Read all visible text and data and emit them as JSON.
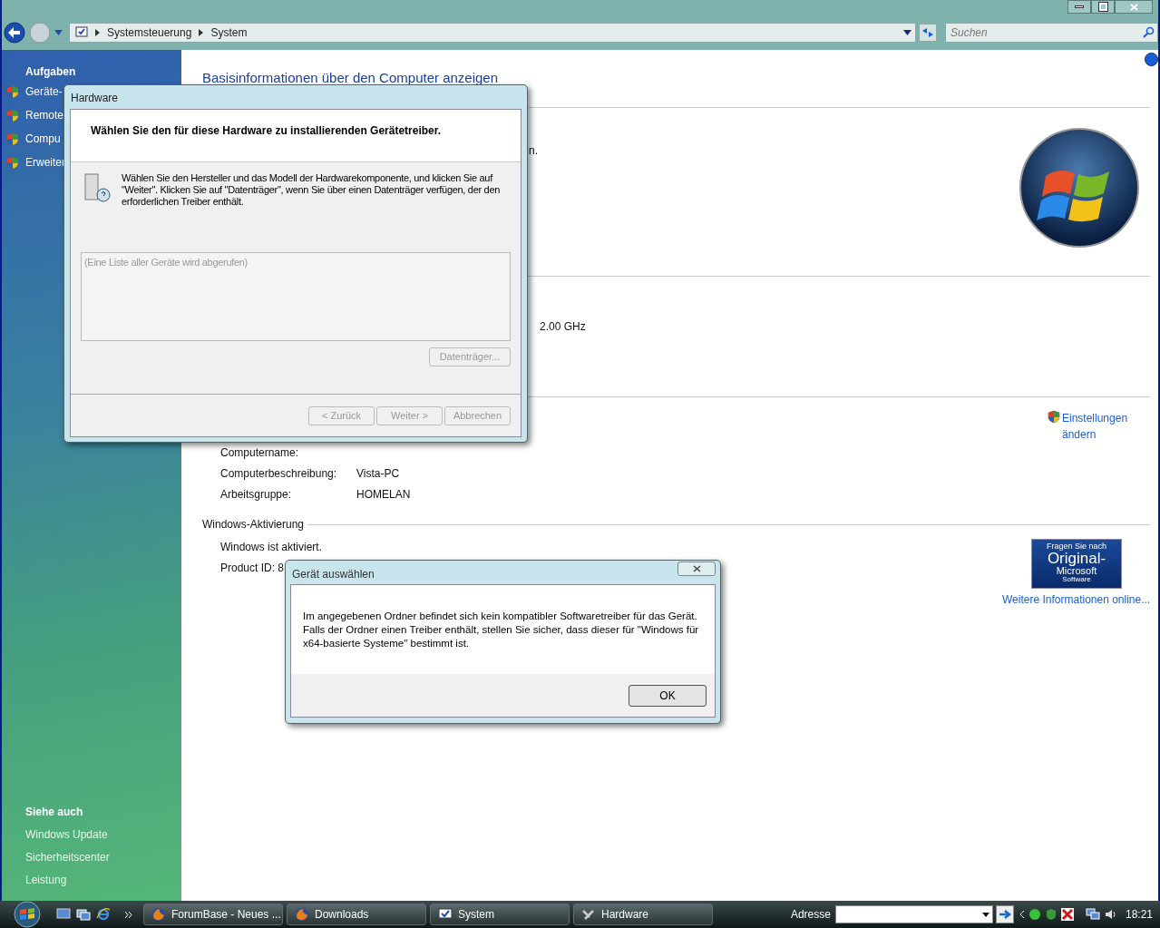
{
  "address_bar": {
    "breadcrumbs": [
      "Systemsteuerung",
      "System"
    ],
    "search": {
      "placeholder": "Suchen"
    }
  },
  "sidebar": {
    "tasks_heading": "Aufgaben",
    "tasks": [
      "Geräte-",
      "Remote",
      "Compu",
      "Erweiter"
    ],
    "see_also_heading": "Siehe auch",
    "see_also": [
      "Windows Update",
      "Sicherheitscenter",
      "Leistung"
    ]
  },
  "content": {
    "title": "Basisinformationen über den Computer anzeigen",
    "fragment_edition": "n.",
    "fragment_cpu": "2.00 GHz",
    "settings_link": "Einstellungen ändern",
    "computer_rows": [
      {
        "label": "Computername:"
      },
      {
        "label": "Computerbeschreibung:",
        "value": "Vista-PC"
      },
      {
        "label": "Arbeitsgruppe:",
        "value": "HOMELAN"
      }
    ],
    "activation": {
      "heading": "Windows-Aktivierung",
      "status": "Windows ist aktiviert.",
      "product_id": "Product ID: 8",
      "badge": {
        "line1": "Fragen Sie nach",
        "line2": "Original-",
        "line3": "Microsoft",
        "line4": "Software"
      },
      "link": "Weitere Informationen online..."
    }
  },
  "hardware_dialog": {
    "title": "Hardware",
    "heading": "Wählen Sie den für diese Hardware zu installierenden Gerätetreiber.",
    "instructions": "Wählen Sie den Hersteller und das Modell der Hardwarekomponente, und klicken Sie auf \"Weiter\". Klicken Sie auf \"Datenträger\", wenn Sie über einen Datenträger verfügen, der den erforderlichen Treiber enthält.",
    "list_placeholder": "(Eine Liste aller Geräte wird abgerufen)",
    "disk_button": {
      "label": "Datenträger...",
      "disabled": true
    },
    "buttons": [
      {
        "label": "< Zurück",
        "disabled": true
      },
      {
        "label": "Weiter >",
        "disabled": true
      },
      {
        "label": "Abbrechen",
        "disabled": true
      }
    ]
  },
  "message_dialog": {
    "title": "Gerät auswählen",
    "message": "Im angegebenen Ordner befindet sich kein kompatibler Softwaretreiber für das Gerät. Falls der Ordner einen Treiber enthält, stellen Sie sicher, dass dieser für \"Windows für x64-basierte Systeme\" bestimmt ist.",
    "button": "OK"
  },
  "taskbar": {
    "tasks": [
      {
        "label": "ForumBase - Neues ...",
        "kind": "browser"
      },
      {
        "label": "Downloads",
        "kind": "browser"
      },
      {
        "label": "System",
        "kind": "system"
      },
      {
        "label": "Hardware",
        "kind": "hardware"
      }
    ],
    "address_label": "Adresse",
    "clock": "18:21"
  }
}
